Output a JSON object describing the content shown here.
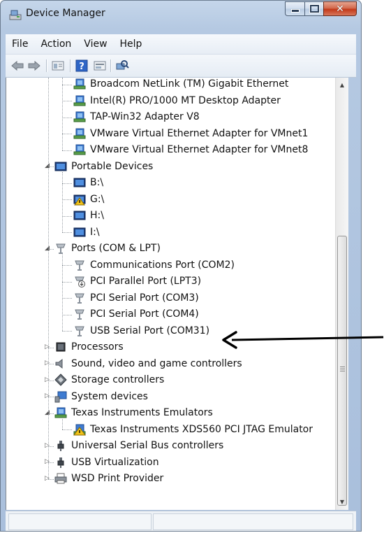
{
  "window": {
    "title": "Device Manager"
  },
  "menu": [
    "File",
    "Action",
    "View",
    "Help"
  ],
  "toolbar": [
    "back-icon",
    "forward-icon",
    "properties-icon",
    "help-icon",
    "show-hidden-icon",
    "scan-hardware-icon"
  ],
  "tree": [
    {
      "label": "Broadcom NetLink (TM) Gigabit Ethernet",
      "level": 2,
      "icon": "network-adapter-icon"
    },
    {
      "label": "Intel(R) PRO/1000 MT Desktop Adapter",
      "level": 2,
      "icon": "network-adapter-icon"
    },
    {
      "label": "TAP-Win32 Adapter V8",
      "level": 2,
      "icon": "network-adapter-icon"
    },
    {
      "label": "VMware Virtual Ethernet Adapter for VMnet1",
      "level": 2,
      "icon": "network-adapter-icon"
    },
    {
      "label": "VMware Virtual Ethernet Adapter for VMnet8",
      "level": 2,
      "icon": "network-adapter-icon"
    },
    {
      "label": "Portable Devices",
      "level": 1,
      "icon": "portable-devices-icon",
      "expander": "expanded"
    },
    {
      "label": "B:\\",
      "level": 2,
      "icon": "portable-device-icon"
    },
    {
      "label": "G:\\",
      "level": 2,
      "icon": "portable-device-warning-icon"
    },
    {
      "label": "H:\\",
      "level": 2,
      "icon": "portable-device-icon"
    },
    {
      "label": "I:\\",
      "level": 2,
      "icon": "portable-device-icon"
    },
    {
      "label": "Ports (COM & LPT)",
      "level": 1,
      "icon": "port-icon",
      "expander": "expanded"
    },
    {
      "label": "Communications Port (COM2)",
      "level": 2,
      "icon": "port-icon"
    },
    {
      "label": "PCI Parallel Port (LPT3)",
      "level": 2,
      "icon": "port-disabled-icon"
    },
    {
      "label": "PCI Serial Port (COM3)",
      "level": 2,
      "icon": "port-icon"
    },
    {
      "label": "PCI Serial Port (COM4)",
      "level": 2,
      "icon": "port-icon"
    },
    {
      "label": "USB Serial Port (COM31)",
      "level": 2,
      "icon": "port-icon"
    },
    {
      "label": "Processors",
      "level": 1,
      "icon": "processor-icon",
      "expander": "collapsed"
    },
    {
      "label": "Sound, video and game controllers",
      "level": 1,
      "icon": "sound-icon",
      "expander": "collapsed"
    },
    {
      "label": "Storage controllers",
      "level": 1,
      "icon": "storage-icon",
      "expander": "collapsed"
    },
    {
      "label": "System devices",
      "level": 1,
      "icon": "system-devices-icon",
      "expander": "collapsed"
    },
    {
      "label": "Texas Instruments Emulators",
      "level": 1,
      "icon": "network-adapter-icon",
      "expander": "expanded"
    },
    {
      "label": "Texas Instruments XDS560 PCI JTAG Emulator",
      "level": 2,
      "icon": "emulator-warning-icon"
    },
    {
      "label": "Universal Serial Bus controllers",
      "level": 1,
      "icon": "usb-icon",
      "expander": "collapsed"
    },
    {
      "label": "USB Virtualization",
      "level": 1,
      "icon": "usb-icon",
      "expander": "collapsed"
    },
    {
      "label": "WSD Print Provider",
      "level": 1,
      "icon": "printer-icon",
      "expander": "collapsed"
    }
  ],
  "colors": {
    "titlebar": "#b5c9e2",
    "close_button": "#c2391a",
    "annotation_arrow": "#000000"
  }
}
